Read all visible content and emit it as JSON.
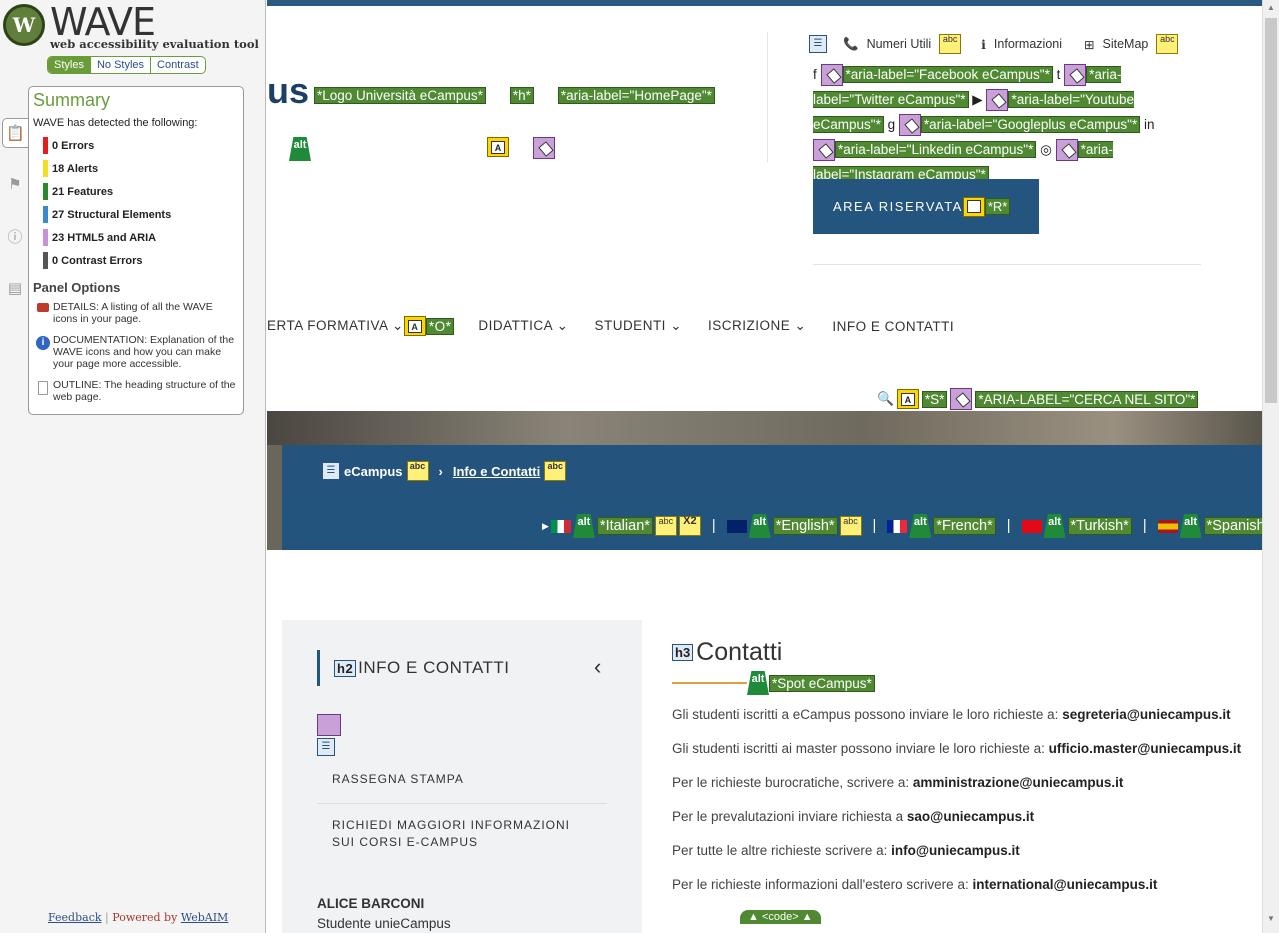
{
  "wave": {
    "title": "WAVE",
    "subtitle": "web accessibility evaluation tool",
    "tabs": [
      "Styles",
      "No Styles",
      "Contrast"
    ],
    "summary_title": "Summary",
    "detected": "WAVE has detected the following:",
    "counts": [
      {
        "label": "0 Errors",
        "color": "#e02020"
      },
      {
        "label": "18 Alerts",
        "color": "#f0e020"
      },
      {
        "label": "21 Features",
        "color": "#2a8a2a"
      },
      {
        "label": "27 Structural Elements",
        "color": "#3a8ad0"
      },
      {
        "label": "23 HTML5 and ARIA",
        "color": "#c890d8"
      },
      {
        "label": "0 Contrast Errors",
        "color": "#555555"
      }
    ],
    "panel_options": "Panel Options",
    "options": [
      "DETAILS: A listing of all the WAVE icons in your page.",
      "DOCUMENTATION: Explanation of the WAVE icons and how you can make your page more accessible.",
      "OUTLINE: The heading structure of the web page."
    ],
    "feedback": "Feedback",
    "powered": "Powered by",
    "webaim": "WebAIM"
  },
  "page": {
    "logo_fragment": "us",
    "logo_labels": [
      "*Logo Università eCampus*",
      "*h*",
      "*aria-label=\"HomePage\"*"
    ],
    "top_links": [
      "Numeri Utili",
      "Informazioni",
      "SiteMap"
    ],
    "social": [
      "*aria-label=\"Facebook eCampus\"*",
      "*aria-label=\"Twitter eCampus\"*",
      "*aria-label=\"Youtube eCampus\"*",
      "*aria-label=\"Googleplus eCampus\"*",
      "*aria-label=\"Linkedin eCampus\"*",
      "*aria-label=\"Instagram eCampus\"*"
    ],
    "area_riservata": "AREA RISERVATA",
    "area_label": "*R*",
    "nav": [
      "ERTA FORMATIVA",
      "DIDATTICA",
      "STUDENTI",
      "ISCRIZIONE",
      "INFO E CONTATTI"
    ],
    "nav_label": "*O*",
    "search_labels": [
      "*S*",
      "*ARIA-LABEL=\"CERCA NEL SITO\"*"
    ],
    "breadcrumb": [
      "eCampus",
      "Info e Contatti"
    ],
    "languages": [
      "*Italian*",
      "*English*",
      "*French*",
      "*Turkish*",
      "*Spanish*"
    ],
    "x2": "X2",
    "sidebar_heading": "INFO E CONTATTI",
    "sidebar_links": [
      "RASSEGNA STAMPA",
      "RICHIEDI MAGGIORI INFORMAZIONI SUI CORSI E-CAMPUS"
    ],
    "person_name": "ALICE BARCONI",
    "person_role": "Studente unieCampus",
    "main_heading": "Contatti",
    "spot_label": "*Spot eCampus*",
    "contacts": [
      {
        "text": "Gli studenti iscritti a eCampus possono inviare le loro richieste a:",
        "email": "segreteria@uniecampus.it"
      },
      {
        "text": "Gli studenti iscritti ai master possono inviare le loro richieste a:",
        "email": "ufficio.master@uniecampus.it"
      },
      {
        "text": "Per le richieste burocratiche, scrivere a:",
        "email": "amministrazione@uniecampus.it"
      },
      {
        "text": "Per le prevalutazioni inviare richiesta a",
        "email": "sao@uniecampus.it"
      },
      {
        "text": "Per tutte le altre richieste scrivere a:",
        "email": "info@uniecampus.it"
      },
      {
        "text": "Per le richieste informazioni dall'estero scrivere a:",
        "email": "international@uniecampus.it"
      }
    ],
    "code_badge": "▲ <code> ▲"
  }
}
